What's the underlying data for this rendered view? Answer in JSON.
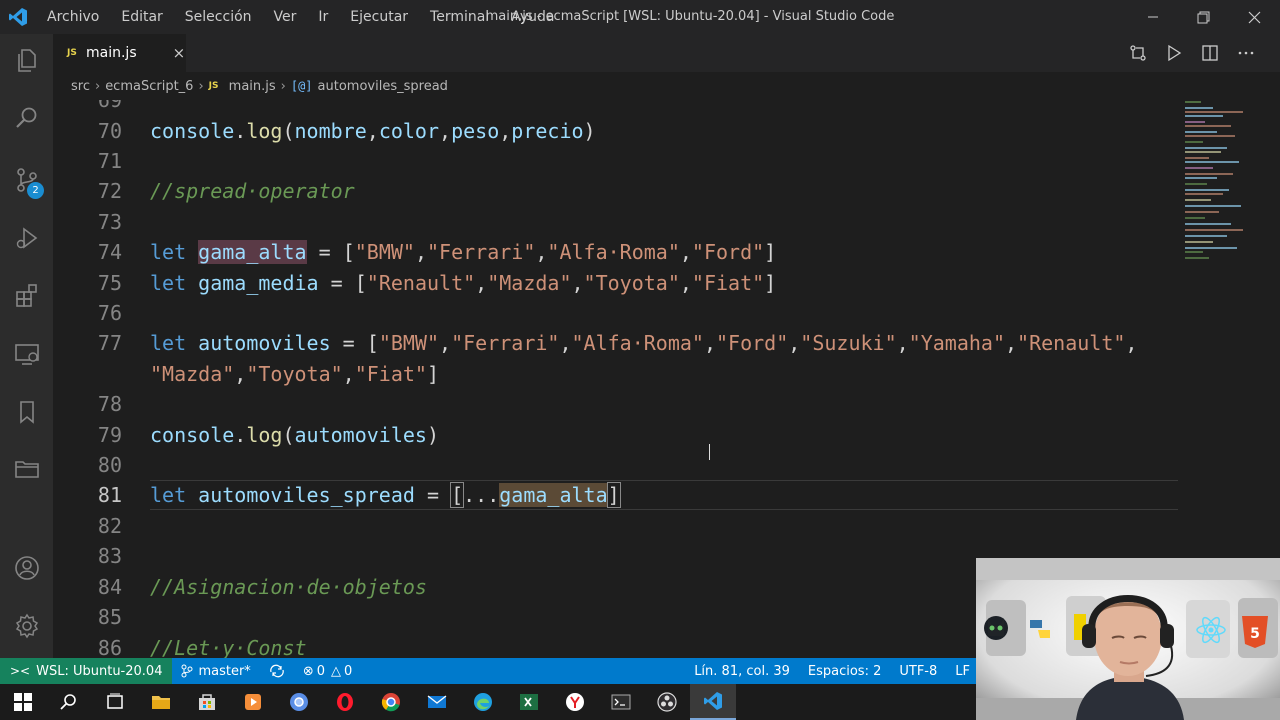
{
  "window": {
    "title": "main.js - ecmaScript [WSL: Ubuntu-20.04] - Visual Studio Code",
    "menu": [
      "Archivo",
      "Editar",
      "Selección",
      "Ver",
      "Ir",
      "Ejecutar",
      "Terminal",
      "Ayuda"
    ]
  },
  "activity_bar": {
    "items": [
      "files-icon",
      "search-icon",
      "source-control-icon",
      "run-debug-icon",
      "extensions-icon",
      "remote-explorer-icon",
      "bookmarks-icon",
      "folder-icon"
    ],
    "source_control_badge": "2",
    "bottom": [
      "account-icon",
      "settings-gear-icon"
    ]
  },
  "tab": {
    "name": "main.js",
    "icon_text": "JS",
    "close": "×"
  },
  "breadcrumb": [
    "src",
    "ecmaScript_6",
    "main.js",
    "automoviles_spread"
  ],
  "editor": {
    "first_partial_line": "69",
    "lines": [
      {
        "n": "70",
        "text": "console.log(nombre,color,peso,precio)"
      },
      {
        "n": "71",
        "text": ""
      },
      {
        "n": "72",
        "text": "//spread·operator"
      },
      {
        "n": "73",
        "text": ""
      },
      {
        "n": "74",
        "text": "let gama_alta = [\"BMW\",\"Ferrari\",\"Alfa·Roma\",\"Ford\"]"
      },
      {
        "n": "75",
        "text": "let gama_media = [\"Renault\",\"Mazda\",\"Toyota\",\"Fiat\"]"
      },
      {
        "n": "76",
        "text": ""
      },
      {
        "n": "77",
        "text": "let automoviles = [\"BMW\",\"Ferrari\",\"Alfa·Roma\",\"Ford\",\"Suzuki\",\"Yamaha\",\"Renault\", \"Mazda\",\"Toyota\",\"Fiat\"]"
      },
      {
        "n": "78",
        "text": ""
      },
      {
        "n": "79",
        "text": "console.log(automoviles)"
      },
      {
        "n": "80",
        "text": ""
      },
      {
        "n": "81",
        "text": "let automoviles_spread = [...gama_alta]"
      },
      {
        "n": "82",
        "text": ""
      },
      {
        "n": "83",
        "text": ""
      },
      {
        "n": "84",
        "text": "//Asignacion·de·objetos"
      },
      {
        "n": "85",
        "text": ""
      },
      {
        "n": "86",
        "text": "//Let·y·Const"
      }
    ]
  },
  "status_bar": {
    "remote": "WSL: Ubuntu-20.04",
    "branch": "master*",
    "errors": "0",
    "warnings": "0",
    "position": "Lín. 81, col. 39",
    "spaces": "Espacios: 2",
    "encoding": "UTF-8",
    "eol": "LF"
  },
  "taskbar": [
    "windows-start-icon",
    "search-icon",
    "task-view-icon",
    "file-explorer-icon",
    "store-icon",
    "media-player-icon",
    "chromium-icon",
    "opera-icon",
    "chrome-icon",
    "mail-icon",
    "edge-icon",
    "excel-icon",
    "yandex-icon",
    "terminal-icon",
    "obs-icon",
    "vscode-icon"
  ],
  "colors": {
    "statusbar": "#007acc",
    "remote": "#16825d",
    "keyword": "#c586c0",
    "string": "#ce9178",
    "variable": "#9cdcfe",
    "function": "#dcdcaa",
    "comment": "#6a9955"
  }
}
